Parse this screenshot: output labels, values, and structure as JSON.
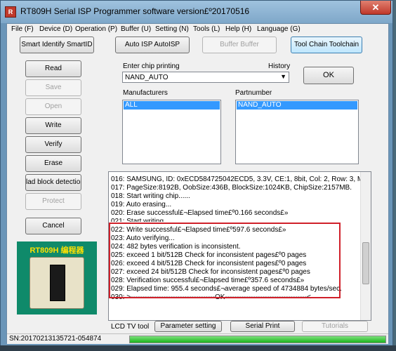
{
  "window": {
    "title": "RT809H Serial ISP Programmer software version£º20170516",
    "app_icon": "R",
    "close": "✕"
  },
  "menu": [
    "File (F)",
    "Device (D)",
    "Operation (P)",
    "Buffer (U)",
    "Setting (N)",
    "Tools (L)",
    "Help (H)",
    "Language (G)"
  ],
  "top_buttons": {
    "smart_identify": "Smart Identify SmartID",
    "auto_isp": "Auto ISP AutoISP",
    "buffer": "Buffer Buffer",
    "tool_chain": "Tool Chain Toolchain"
  },
  "side_buttons": {
    "read": "Read",
    "save": "Save",
    "open": "Open",
    "write": "Write",
    "verify": "Verify",
    "erase": "Erase",
    "bad_block": "lad block detection I",
    "protect": "Protect",
    "cancel": "Cancel"
  },
  "chip": {
    "enter_label": "Enter chip printing",
    "history_label": "History",
    "value": "NAND_AUTO",
    "ok": "OK"
  },
  "manufacturers": {
    "label": "Manufacturers",
    "items": [
      "ALL"
    ]
  },
  "partnumber": {
    "label": "Partnumber",
    "items": [
      "NAND_AUTO"
    ]
  },
  "log": [
    "016: SAMSUNG, ID: 0xECD584725042ECD5, 3.3V, CE:1, 8bit, Col: 2, Row: 3, MLC.",
    "017: PageSize:8192B, OobSize:436B, BlockSize:1024KB, ChipSize:2157MB.",
    "018: Start writing chip......",
    "019: Auto erasing...",
    "020: Erase successful£¬Elapsed time£º0.166 seconds£»",
    "021: Start writing...",
    "022: Write successful£¬Elapsed time£º597.6 seconds£»",
    "023: Auto verifying...",
    "024: 482 bytes verification is inconsistent.",
    "025: exceed 1 bit/512B Check for inconsistent pages£º0 pages",
    "026: exceed 4 bit/512B Check for inconsistent pages£º0 pages",
    "027: exceed 24 bit/512B Check for inconsistent pages£º0 pages",
    "028: Verification successful£¬Elapsed time£º357.6 seconds£»",
    "029: Elapsed time: 955.4 seconds£¬average speed of 4734884 bytes/sec.",
    "030: >------------------------------------OK-----------------------------------<"
  ],
  "logo_text": "RT809H 编程器",
  "bottom_tools": {
    "lcd_label": "LCD TV tool",
    "parameter": "Parameter setting",
    "serial": "Serial Print",
    "tutorials": "Tutorials"
  },
  "status": {
    "sn": "SN:20170213135721-054874",
    "progress": 1.0
  },
  "colors": {
    "highlight": "#d0202a",
    "selection": "#3399ff",
    "progress": "#1cb51c",
    "logo_bg": "#0f8a6a",
    "logo_text": "#ffe000"
  }
}
